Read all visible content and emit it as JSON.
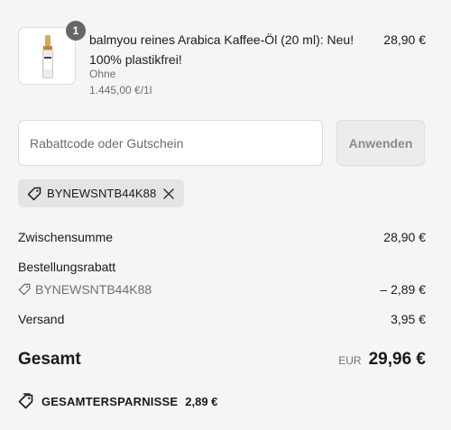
{
  "product": {
    "quantity_badge": "1",
    "title": "balmyou reines Arabica Kaffee-Öl (20 ml): Neu! 100% plastikfrei!",
    "variant": "Ohne",
    "unit_price": "1.445,00 €/1l",
    "price": "28,90 €"
  },
  "discount_form": {
    "placeholder": "Rabattcode oder Gutschein",
    "value": "",
    "apply_label": "Anwenden"
  },
  "applied_code": {
    "code": "BYNEWSNTB44K88",
    "icon": "tag-icon"
  },
  "summary": {
    "subtotal_label": "Zwischensumme",
    "subtotal_value": "28,90 €",
    "order_discount_label": "Bestellungsrabatt",
    "discount_code": "BYNEWSNTB44K88",
    "discount_value": "– 2,89 €",
    "shipping_label": "Versand",
    "shipping_value": "3,95 €",
    "total_label": "Gesamt",
    "total_currency": "EUR",
    "total_value": "29,96 €",
    "savings_label": "GESAMTERSPARNISSE",
    "savings_value": "2,89 €"
  },
  "colors": {
    "background": "#f5f5f5",
    "badge": "#666666",
    "chip_background": "#e4e4e4",
    "muted_text": "#707070"
  }
}
